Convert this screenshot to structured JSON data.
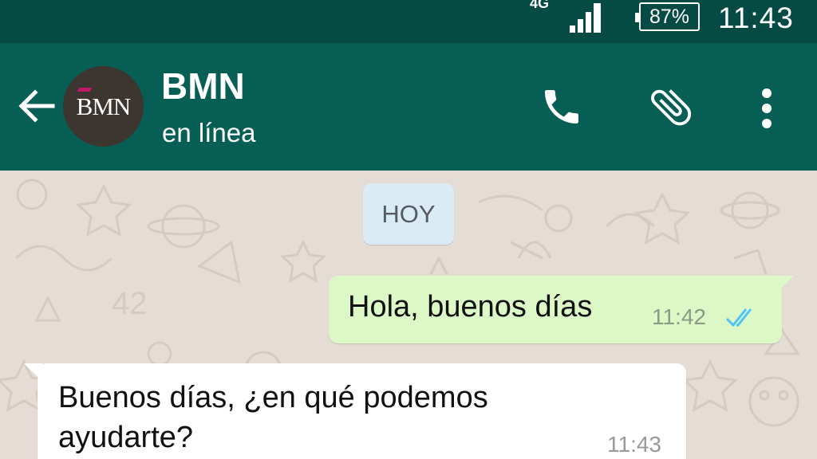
{
  "status_bar": {
    "network": "4G",
    "battery": "87%",
    "time": "11:43"
  },
  "header": {
    "avatar_logo": "BMN",
    "contact_name": "BMN",
    "contact_status": "en línea",
    "icons": [
      "back-arrow-icon",
      "phone-icon",
      "paperclip-icon",
      "more-vertical-icon"
    ]
  },
  "chat": {
    "date_chip": "HOY",
    "messages": [
      {
        "direction": "outgoing",
        "text": "Hola, buenos días",
        "time": "11:42",
        "status": "double-check-read-icon"
      },
      {
        "direction": "incoming",
        "text": "Buenos días, ¿en qué podemos ayudarte?",
        "time": "11:43"
      }
    ]
  },
  "colors": {
    "status_bar": "#064b43",
    "app_bar": "#075e54",
    "chat_background": "#e5ddd5",
    "outgoing_bubble": "#dcf8c6",
    "incoming_bubble": "#ffffff",
    "date_chip": "#d9ecf6",
    "read_ticks": "#4fc3f7"
  }
}
